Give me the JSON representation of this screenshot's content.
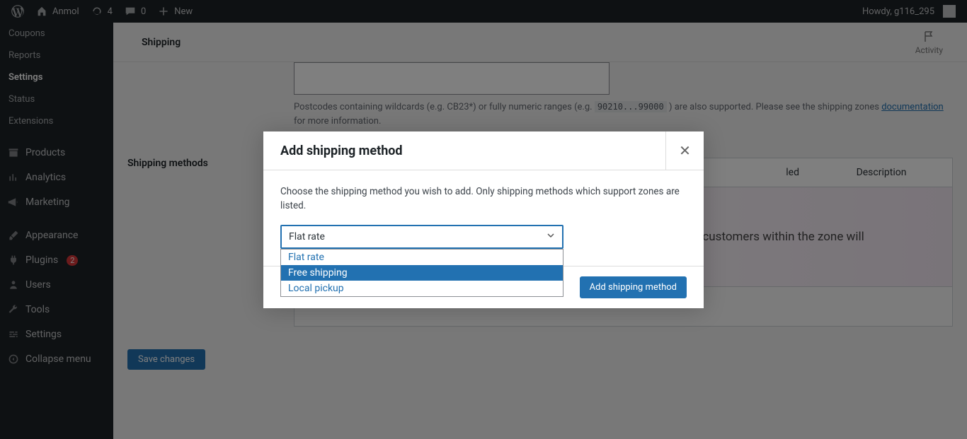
{
  "adminbar": {
    "site_name": "Anmol",
    "updates_count": "4",
    "comments_count": "0",
    "new_label": "New",
    "howdy": "Howdy, g116_295"
  },
  "sidebar": {
    "sub_items": [
      "Coupons",
      "Reports",
      "Settings",
      "Status",
      "Extensions"
    ],
    "sub_active_index": 2,
    "top_items": [
      {
        "icon": "archive",
        "label": "Products"
      },
      {
        "icon": "chart",
        "label": "Analytics"
      },
      {
        "icon": "megaphone",
        "label": "Marketing"
      },
      {
        "icon": "brush",
        "label": "Appearance"
      },
      {
        "icon": "plug",
        "label": "Plugins",
        "badge": "2"
      },
      {
        "icon": "user",
        "label": "Users"
      },
      {
        "icon": "wrench",
        "label": "Tools"
      },
      {
        "icon": "sliders",
        "label": "Settings"
      },
      {
        "icon": "collapse",
        "label": "Collapse menu"
      }
    ]
  },
  "page": {
    "title": "Shipping",
    "activity_label": "Activity",
    "postcode_help_prefix": "Postcodes containing wildcards (e.g. CB23*) or fully numeric ranges (e.g. ",
    "postcode_help_code": "90210...99000",
    "postcode_help_suffix": " ) are also supported. Please see the shipping zones ",
    "postcode_help_link": "documentation",
    "postcode_help_tail": " for more information.",
    "methods_label": "Shipping methods",
    "table_head_enabled": "led",
    "table_head_desc": "Description",
    "table_body_hint": "ly customers within the zone will",
    "save_label": "Save changes"
  },
  "modal": {
    "title": "Add shipping method",
    "desc": "Choose the shipping method you wish to add. Only shipping methods which support zones are listed.",
    "selected": "Flat rate",
    "options": [
      "Flat rate",
      "Free shipping",
      "Local pickup"
    ],
    "highlight_index": 1,
    "submit_label": "Add shipping method"
  }
}
